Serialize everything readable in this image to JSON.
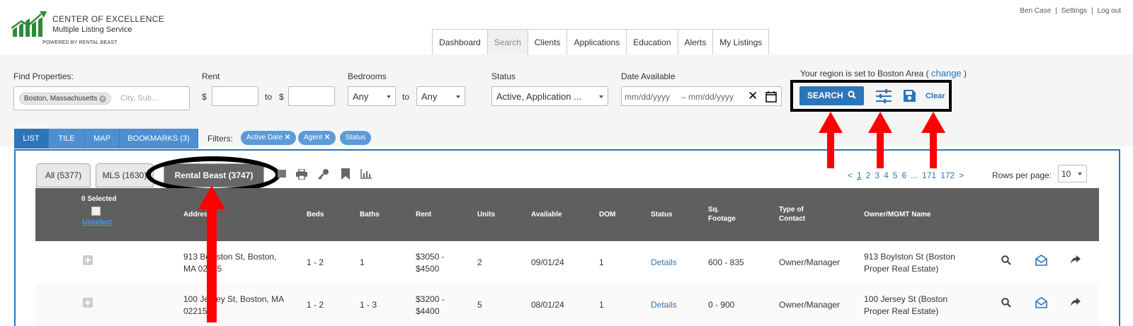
{
  "header": {
    "logo_line1": "CENTER OF  EXCELLENCE",
    "logo_line2": "Multiple Listing  Service",
    "logo_line3": "POWERED BY RENTAL BEAST",
    "user": "Ben Case",
    "settings": "Settings",
    "logout": "Log out",
    "sep": "|"
  },
  "nav": {
    "tabs": [
      "Dashboard",
      "Search",
      "Clients",
      "Applications",
      "Education",
      "Alerts",
      "My Listings"
    ],
    "active": 1
  },
  "search": {
    "find_label": "Find Properties:",
    "location_chip": "Boston, Massachusetts",
    "location_placeholder": "City, Sub...",
    "rent_label": "Rent",
    "currency": "$",
    "to": "to",
    "bedrooms_label": "Bedrooms",
    "bed_min": "Any",
    "bed_max": "Any",
    "status_label": "Status",
    "status_value": "Active, Application ...",
    "date_label": "Date Available",
    "date_from": "mm/dd/yyyy",
    "date_dash": "–",
    "date_to": "mm/dd/yyyy",
    "region_text": "Your region is set to Boston Area (",
    "region_change": "change",
    "region_close": ")",
    "search_button": "SEARCH",
    "clear_button": "Clear"
  },
  "views": {
    "tabs": [
      "LIST",
      "TILE",
      "MAP",
      "BOOKMARKS (3)"
    ],
    "active": 0,
    "filters_label": "Filters:",
    "filters": [
      "Active Date",
      "Agent",
      "Status"
    ]
  },
  "results": {
    "tabs": [
      "All (5377)",
      "MLS (1630)",
      "Rental Beast (3747)"
    ],
    "active": 2,
    "pager": [
      "<",
      "1",
      "2",
      "3",
      "4",
      "5",
      "6",
      "...",
      "171",
      "172",
      ">"
    ],
    "rows_per_page_label": "Rows per page:",
    "rows_per_page": "10",
    "selected": "0 Selected",
    "unselect": "Unselect",
    "columns": [
      "Address",
      "Beds",
      "Baths",
      "Rent",
      "Units",
      "Available",
      "DOM",
      "Status",
      "Sq. Footage",
      "Type of Contact",
      "Owner/MGMT Name"
    ],
    "rows": [
      {
        "address": "913 Boylston St, Boston, MA 02215",
        "beds": "1 - 2",
        "baths": "1",
        "rent": "$3050 - $4500",
        "units": "2",
        "available": "09/01/24",
        "dom": "1",
        "status": "Details",
        "sqft": "600 - 835",
        "contact": "Owner/Manager",
        "owner": "913 Boylston St (Boston Proper Real Estate)"
      },
      {
        "address": "100 Jersey St, Boston, MA 02215",
        "beds": "1 - 2",
        "baths": "1 - 3",
        "rent": "$3200 - $4400",
        "units": "5",
        "available": "08/01/24",
        "dom": "1",
        "status": "Details",
        "sqft": "0 - 900",
        "contact": "Owner/Manager",
        "owner": "100 Jersey St (Boston Proper Real Estate)"
      }
    ]
  },
  "colors": {
    "accent": "#2d75b8",
    "annotation": "#ff0000"
  }
}
